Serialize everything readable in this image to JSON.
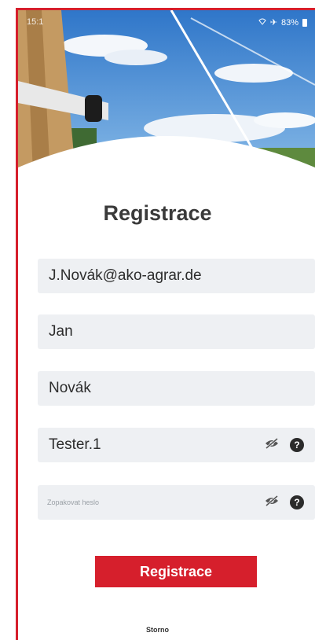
{
  "status_bar": {
    "time": "15:1",
    "battery": "83%"
  },
  "title": "Registrace",
  "fields": {
    "email": {
      "value": "J.Novák@ako-agrar.de"
    },
    "first_name": {
      "value": "Jan"
    },
    "last_name": {
      "value": "Novák"
    },
    "password": {
      "value": "Tester.1"
    },
    "confirm_password": {
      "placeholder": "Zopakovat heslo"
    }
  },
  "submit_label": "Registrace",
  "cancel_label": "Storno",
  "colors": {
    "accent": "#d61f2c",
    "field_bg": "#eef0f3",
    "title": "#3a3a3a"
  },
  "icons": [
    "wifi-icon",
    "airplane-icon",
    "battery-icon",
    "eye-slash-icon",
    "help-icon"
  ]
}
